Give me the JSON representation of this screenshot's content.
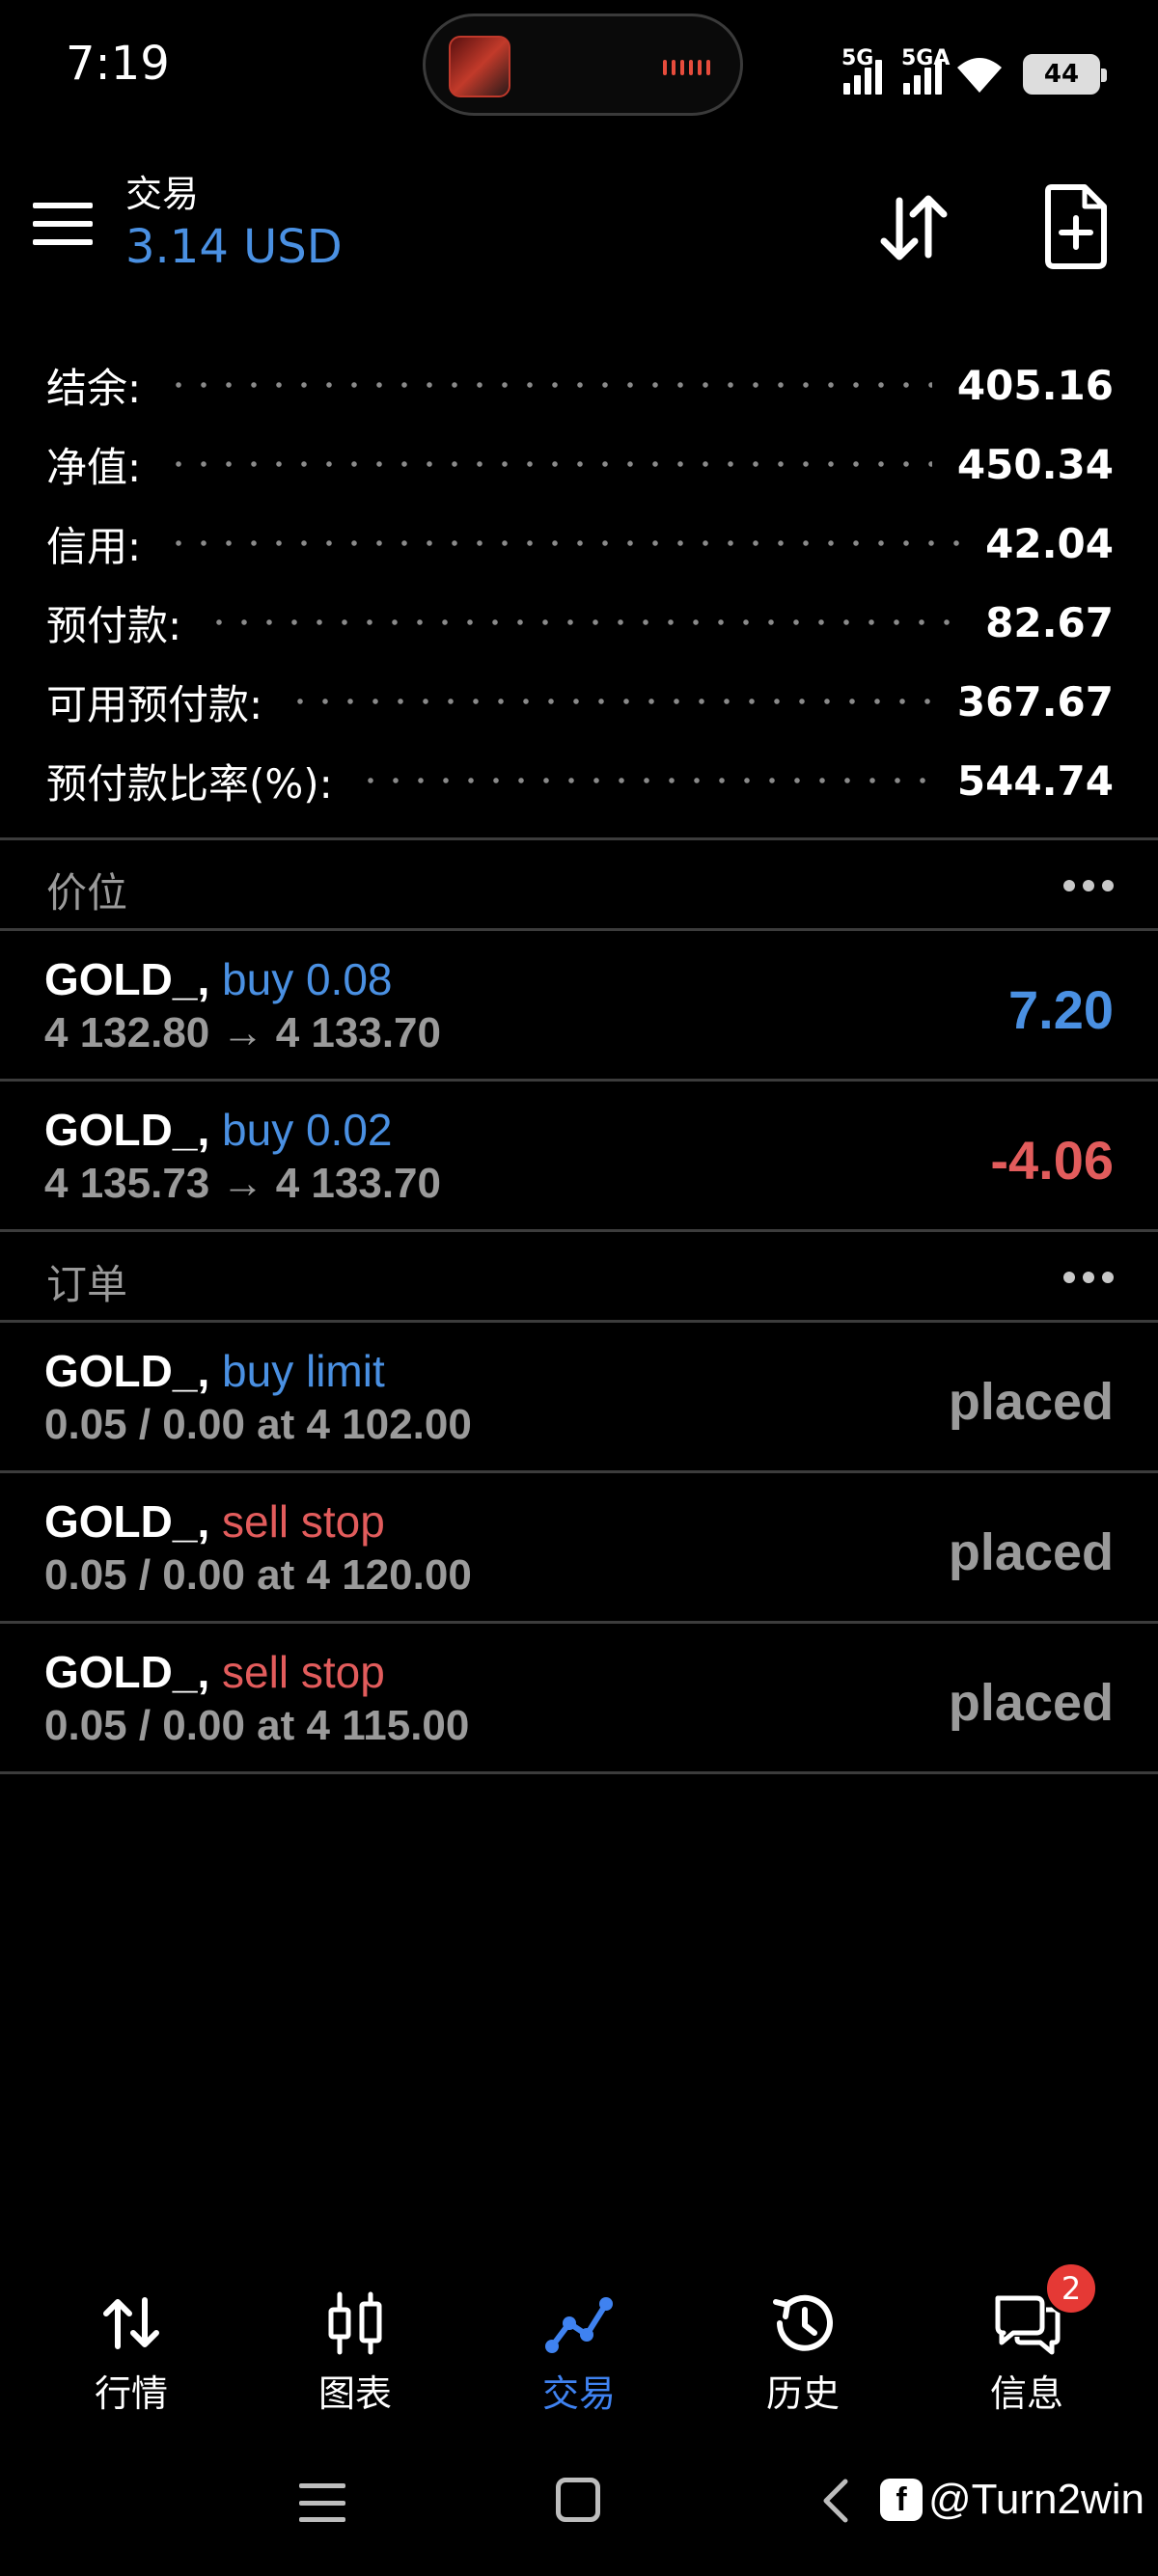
{
  "status_bar": {
    "time": "7:19",
    "network_1": "5G",
    "network_2": "5GA",
    "battery": "44"
  },
  "header": {
    "title": "交易",
    "subtitle": "3.14 USD"
  },
  "summary": [
    {
      "label": "结余:",
      "value": "405.16"
    },
    {
      "label": "净值:",
      "value": "450.34"
    },
    {
      "label": "信用:",
      "value": "42.04"
    },
    {
      "label": "预付款:",
      "value": "82.67"
    },
    {
      "label": "可用预付款:",
      "value": "367.67"
    },
    {
      "label": "预付款比率(%):",
      "value": "544.74"
    }
  ],
  "positions": {
    "title": "价位",
    "items": [
      {
        "symbol": "GOLD_,",
        "type": "buy 0.08",
        "prices": "4 132.80 → 4 133.70",
        "profit": "7.20"
      },
      {
        "symbol": "GOLD_,",
        "type": "buy 0.02",
        "prices": "4 135.73 → 4 133.70",
        "profit": "-4.06"
      }
    ]
  },
  "orders": {
    "title": "订单",
    "items": [
      {
        "symbol": "GOLD_,",
        "type": "buy limit",
        "detail": "0.05 / 0.00 at 4 102.00",
        "status": "placed"
      },
      {
        "symbol": "GOLD_,",
        "type": "sell stop",
        "detail": "0.05 / 0.00 at 4 120.00",
        "status": "placed"
      },
      {
        "symbol": "GOLD_,",
        "type": "sell stop",
        "detail": "0.05 / 0.00 at 4 115.00",
        "status": "placed"
      }
    ]
  },
  "bottom_nav": {
    "items": [
      {
        "label": "行情",
        "icon": "quotes-arrows-icon"
      },
      {
        "label": "图表",
        "icon": "candlestick-chart-icon"
      },
      {
        "label": "交易",
        "icon": "trade-line-icon"
      },
      {
        "label": "历史",
        "icon": "history-clock-icon"
      },
      {
        "label": "信息",
        "icon": "messages-icon"
      }
    ],
    "active": "交易",
    "badge_count": "2"
  },
  "watermark": "@Turn2win",
  "colors": {
    "accent_blue": "#4a90e2",
    "loss_red": "#e25c5c",
    "background": "#000000"
  }
}
